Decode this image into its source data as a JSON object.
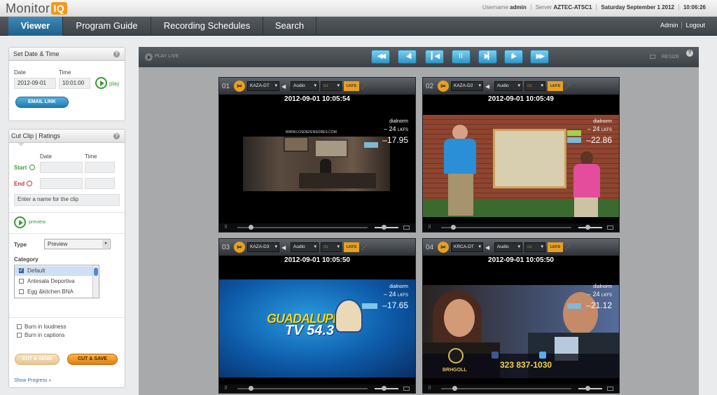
{
  "app": {
    "logo_text": "Monitor",
    "logo_box": "IQ"
  },
  "header": {
    "username_label": "Username",
    "username": "admin",
    "server_label": "Server",
    "server": "AZTEC-ATSC1",
    "date": "Saturday September 1 2012",
    "time": "10:06:26"
  },
  "nav": {
    "tabs": [
      "Viewer",
      "Program Guide",
      "Recording Schedules",
      "Search"
    ],
    "active": "Viewer",
    "admin": "Admin",
    "logout": "Logout"
  },
  "set_date": {
    "title": "Set Date & Time",
    "date_label": "Date",
    "time_label": "Time",
    "date_value": "2012-09-01",
    "time_value": "10:01:00",
    "play_label": "play",
    "email_link": "EMAIL LINK"
  },
  "cut_clip": {
    "tabs": [
      "Cut Clip",
      "Ratings"
    ],
    "date_col": "Date",
    "time_col": "Time",
    "start_label": "Start",
    "end_label": "End",
    "name_placeholder": "Enter a name for the clip",
    "preview_label": "preview",
    "type_label": "Type",
    "type_value": "Preview",
    "category_label": "Category",
    "categories": [
      "Default",
      "Antesala Deportiva",
      "Egg &kitchen BNA"
    ],
    "categories_checked": [
      true,
      false,
      false
    ],
    "burn_loudness": "Burn in loudness",
    "burn_captions": "Burn in captions",
    "cut_send": "CUT & SEND",
    "cut_save": "CUT & SAVE",
    "show_progress": "Show Progress »"
  },
  "player": {
    "play_live": "PLAY LIVE",
    "resize": "RESIZE"
  },
  "tiles": [
    {
      "num": "01",
      "channel": "KAZA-DT",
      "audio": "Audio",
      "lkfs_btn": "LKFS",
      "timestamp": "2012-09-01 10:05:54",
      "dialnorm": "dialnorm",
      "target": "– 24",
      "unit": "LKFS",
      "reading": "–17.95"
    },
    {
      "num": "02",
      "channel": "KAZA-D2",
      "audio": "Audio",
      "lkfs_btn": "LKFS",
      "timestamp": "2012-09-01 10:05:49",
      "dialnorm": "dialnorm",
      "target": "– 24",
      "unit": "LKFS",
      "reading": "–22.86"
    },
    {
      "num": "03",
      "channel": "KAZA-D3",
      "audio": "Audio",
      "lkfs_btn": "LKFS",
      "timestamp": "2012-09-01 10:05:50",
      "dialnorm": "dialnorm",
      "target": "– 24",
      "unit": "LKFS",
      "reading": "–17.65"
    },
    {
      "num": "04",
      "channel": "KRCA-DT",
      "audio": "Audio",
      "lkfs_btn": "LKFS",
      "timestamp": "2012-09-01 10:05:50",
      "dialnorm": "dialnorm",
      "target": "– 24",
      "unit": "LKFS",
      "reading": "–21.12"
    }
  ],
  "overlays": {
    "tile1_url": "WWW.LOSDEFENSORES.COM",
    "tile3_logo": "GUADALUPE",
    "tile3_tv": "TV 54.3",
    "tile4_phone": "323 837-1030",
    "tile4_brand": "BRHGOLL"
  }
}
